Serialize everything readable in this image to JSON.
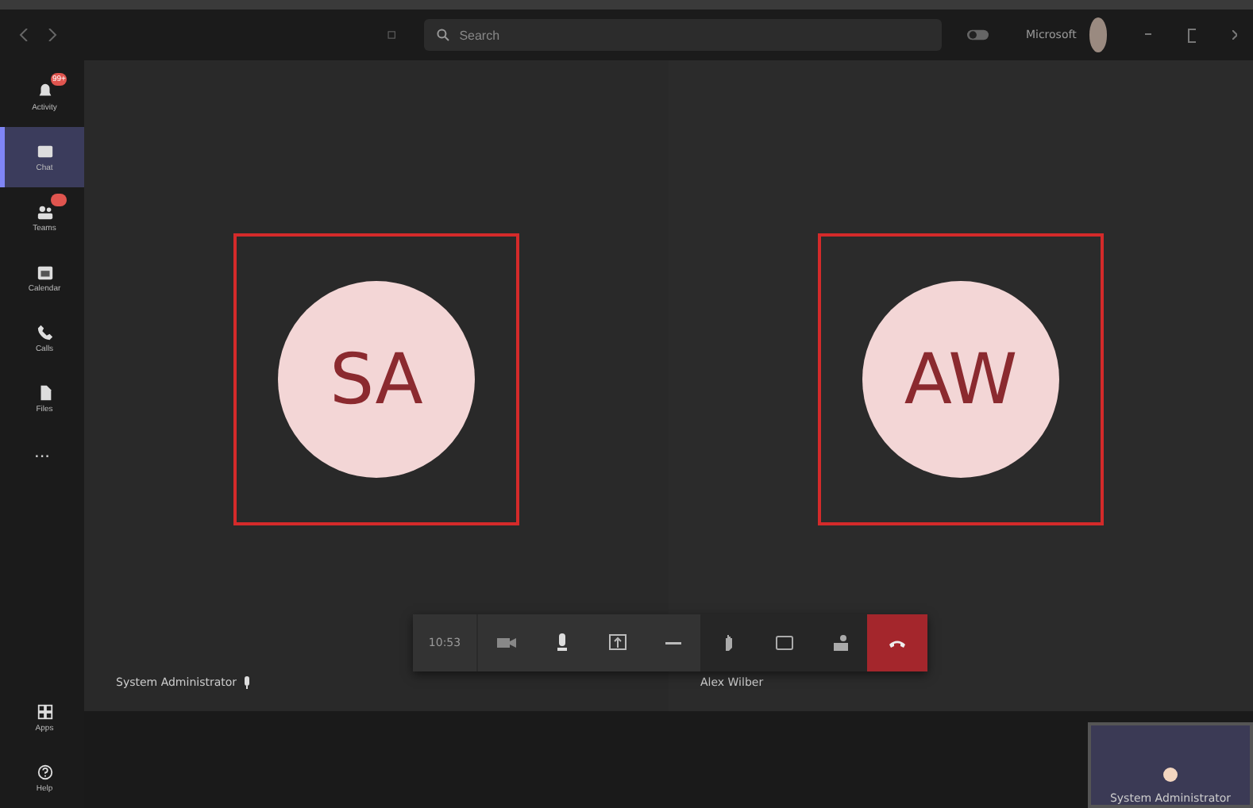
{
  "top_bar": {
    "search": {
      "placeholder": "Search"
    },
    "toggle": {
      "on": false
    },
    "account": "Microsoft"
  },
  "rail": {
    "items": [
      {
        "label": "Activity",
        "kind": "activity",
        "selected": false,
        "badge": "99+"
      },
      {
        "label": "Chat",
        "kind": "chat",
        "selected": true
      },
      {
        "label": "Teams",
        "kind": "teams",
        "selected": false,
        "dot": true
      },
      {
        "label": "Calendar",
        "kind": "calendar",
        "selected": false
      },
      {
        "label": "Calls",
        "kind": "calls",
        "selected": false
      },
      {
        "label": "Files",
        "kind": "files",
        "selected": false
      }
    ],
    "more": "...",
    "bottom_items": [
      {
        "label": "Apps",
        "kind": "apps"
      },
      {
        "label": "Help",
        "kind": "help"
      }
    ]
  },
  "participants": [
    {
      "initials": "SA",
      "name": "System Administrator",
      "muted": true,
      "highlighted": true
    },
    {
      "initials": "AW",
      "name": "Alex Wilber",
      "muted": false,
      "highlighted": true
    }
  ],
  "call_controls": {
    "timer": "10:53"
  },
  "self_view": {
    "name": "System Administrator"
  }
}
